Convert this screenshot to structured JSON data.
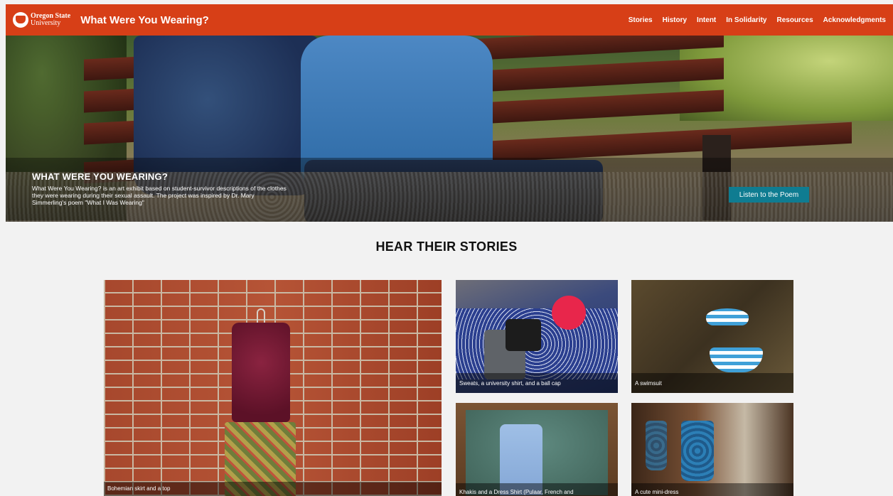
{
  "header": {
    "logo_line1": "Oregon State",
    "logo_line2": "University",
    "site_title": "What Were You Wearing?",
    "nav": [
      "Stories",
      "History",
      "Intent",
      "In Solidarity",
      "Resources",
      "Acknowledgments"
    ],
    "accent_color": "#d73f17"
  },
  "hero": {
    "title": "WHAT WERE YOU WEARING?",
    "text": "What Were You Wearing? is an art exhibit based on student-survivor descriptions of the clothes they were wearing during their sexual assault. The project was inspired by Dr. Mary Simmerling's poem \"What I Was Wearing\"",
    "button": "Listen to the Poem",
    "button_color": "#0f7c91"
  },
  "stories": {
    "title": "HEAR THEIR STORIES",
    "cards": [
      {
        "caption": "Bohemian skirt and a top"
      },
      {
        "caption": "Sweats, a university shirt, and a ball cap"
      },
      {
        "caption": "A swimsuit"
      },
      {
        "caption": "Khakis and a Dress Shirt (Pulaar, French and"
      },
      {
        "caption": "A cute mini-dress"
      }
    ]
  }
}
